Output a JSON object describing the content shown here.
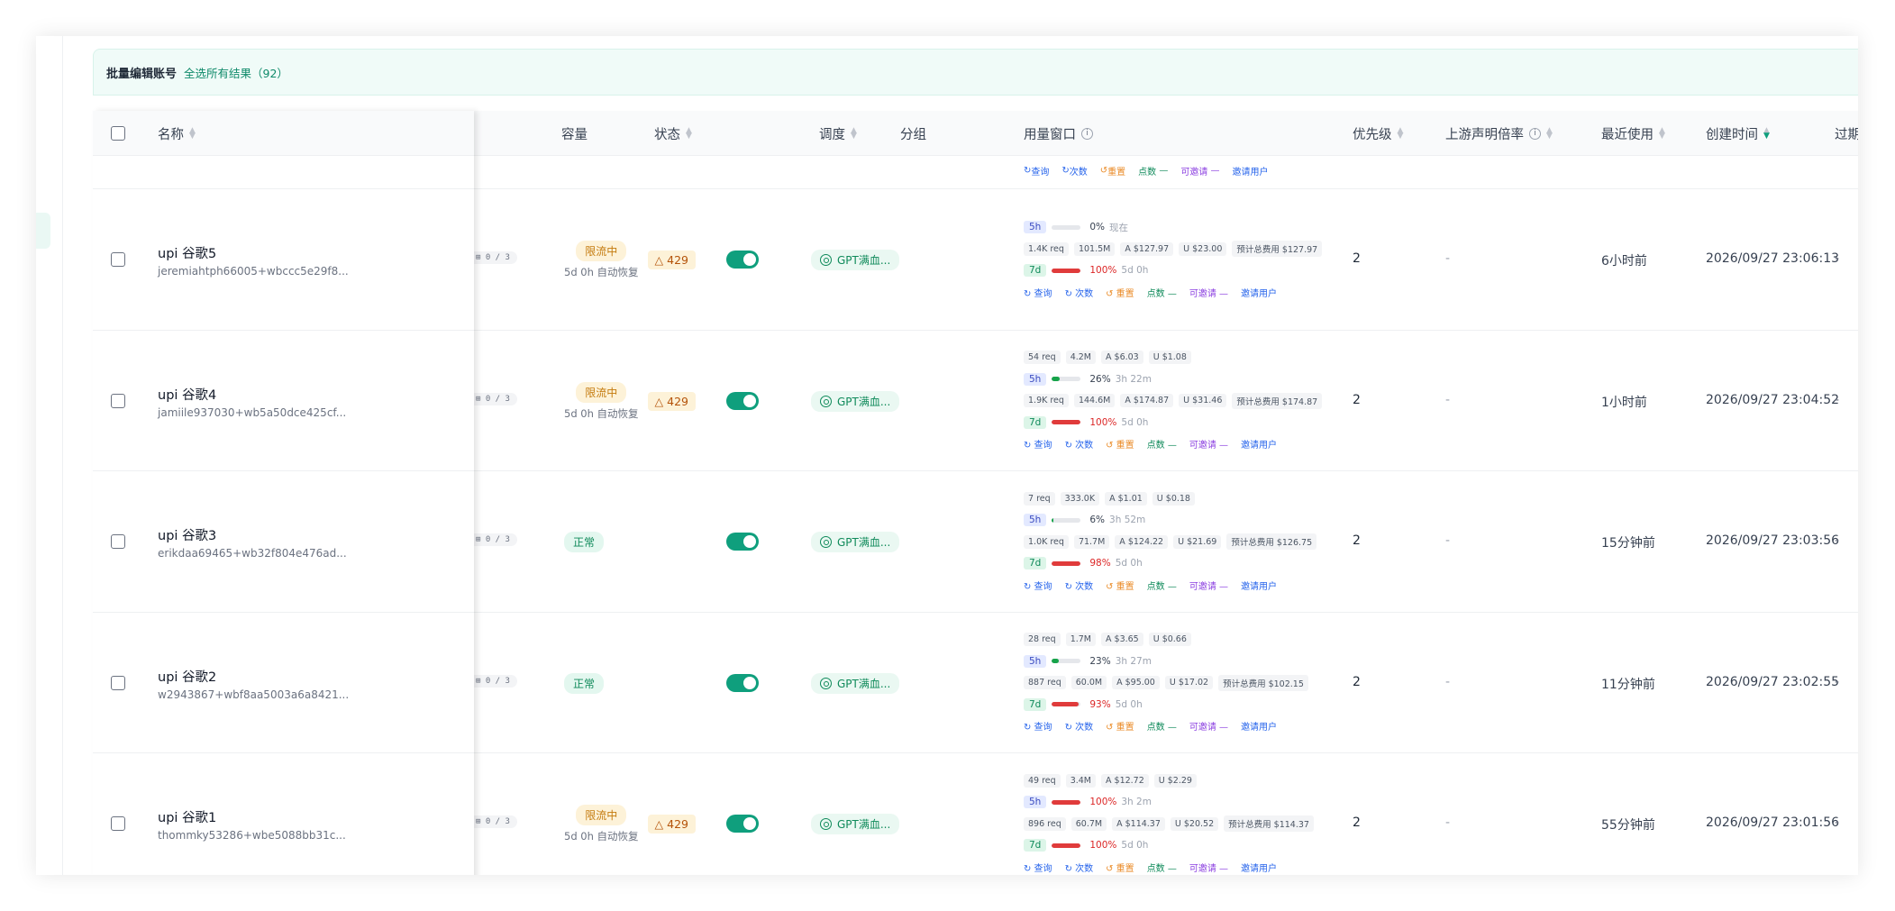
{
  "bulkbar": {
    "title": "批量编辑账号",
    "select_all": "全选所有结果（92）"
  },
  "columns": {
    "name": "名称",
    "capacity": "容量",
    "status": "状态",
    "schedule": "调度",
    "group": "分组",
    "usage_window": "用量窗口",
    "priority": "优先级",
    "upstream_rate": "上游声明倍率",
    "last_used": "最近使用",
    "created_at": "创建时间",
    "expire": "过期"
  },
  "usage_actions": {
    "query": "查询",
    "count": "次数",
    "reset": "重置",
    "points": "点数",
    "points_val": "—",
    "can_invite": "可邀请",
    "can_invite_val": "—",
    "invite_user": "邀请用户"
  },
  "rows": [
    {
      "name": "upi 谷歌5",
      "email": "jeremiahtph66005+wbccc5e29f8...",
      "capacity": "⊞ 0 / 3",
      "status": "限流中",
      "status_type": "limit",
      "status_sub": "5d 0h 自动恢复",
      "code": "△ 429",
      "group": "GPT满血...",
      "usage_5h": {
        "label": "5h",
        "pct": "0%",
        "fill": 0,
        "reset": "现在",
        "color": "gray"
      },
      "chips_7d": [
        "1.4K req",
        "101.5M",
        "A $127.97",
        "U $23.00",
        "预计总费用 $127.97"
      ],
      "usage_7d": {
        "label": "7d",
        "pct": "100%",
        "fill": 100,
        "reset": "5d 0h"
      },
      "priority": "2",
      "upstream": "-",
      "last_used": "6小时前",
      "created": "2026/09/27 23:06:13",
      "expire": "-"
    },
    {
      "name": "upi 谷歌4",
      "email": "jamiile937030+wb5a50dce425cf...",
      "capacity": "⊞ 0 / 3",
      "status": "限流中",
      "status_type": "limit",
      "status_sub": "5d 0h 自动恢复",
      "code": "△ 429",
      "group": "GPT满血...",
      "chips_5h": [
        "54 req",
        "4.2M",
        "A $6.03",
        "U $1.08"
      ],
      "usage_5h": {
        "label": "5h",
        "pct": "26%",
        "fill": 26,
        "reset": "3h 22m",
        "color": "green"
      },
      "chips_7d": [
        "1.9K req",
        "144.6M",
        "A $174.87",
        "U $31.46",
        "预计总费用 $174.87"
      ],
      "usage_7d": {
        "label": "7d",
        "pct": "100%",
        "fill": 100,
        "reset": "5d 0h"
      },
      "priority": "2",
      "upstream": "-",
      "last_used": "1小时前",
      "created": "2026/09/27 23:04:52",
      "expire": "-"
    },
    {
      "name": "upi 谷歌3",
      "email": "erikdaa69465+wb32f804e476ad...",
      "capacity": "⊞ 0 / 3",
      "status": "正常",
      "status_type": "ok",
      "status_sub": "",
      "code": "",
      "group": "GPT满血...",
      "chips_5h": [
        "7 req",
        "333.0K",
        "A $1.01",
        "U $0.18"
      ],
      "usage_5h": {
        "label": "5h",
        "pct": "6%",
        "fill": 6,
        "reset": "3h 52m",
        "color": "green"
      },
      "chips_7d": [
        "1.0K req",
        "71.7M",
        "A $124.22",
        "U $21.69",
        "预计总费用 $126.75"
      ],
      "usage_7d": {
        "label": "7d",
        "pct": "98%",
        "fill": 98,
        "reset": "5d 0h"
      },
      "priority": "2",
      "upstream": "-",
      "last_used": "15分钟前",
      "created": "2026/09/27 23:03:56",
      "expire": "-"
    },
    {
      "name": "upi 谷歌2",
      "email": "w2943867+wbf8aa5003a6a8421...",
      "capacity": "⊞ 0 / 3",
      "status": "正常",
      "status_type": "ok",
      "status_sub": "",
      "code": "",
      "group": "GPT满血...",
      "chips_5h": [
        "28 req",
        "1.7M",
        "A $3.65",
        "U $0.66"
      ],
      "usage_5h": {
        "label": "5h",
        "pct": "23%",
        "fill": 23,
        "reset": "3h 27m",
        "color": "green"
      },
      "chips_7d": [
        "887 req",
        "60.0M",
        "A $95.00",
        "U $17.02",
        "预计总费用 $102.15"
      ],
      "usage_7d": {
        "label": "7d",
        "pct": "93%",
        "fill": 93,
        "reset": "5d 0h"
      },
      "priority": "2",
      "upstream": "-",
      "last_used": "11分钟前",
      "created": "2026/09/27 23:02:55",
      "expire": "-"
    },
    {
      "name": "upi 谷歌1",
      "email": "thommky53286+wbe5088bb31c...",
      "capacity": "⊞ 0 / 3",
      "status": "限流中",
      "status_type": "limit",
      "status_sub": "5d 0h 自动恢复",
      "code": "△ 429",
      "group": "GPT满血...",
      "chips_5h": [
        "49 req",
        "3.4M",
        "A $12.72",
        "U $2.29"
      ],
      "usage_5h": {
        "label": "5h",
        "pct": "100%",
        "fill": 100,
        "reset": "3h 2m",
        "color": "red"
      },
      "chips_7d": [
        "896 req",
        "60.7M",
        "A $114.37",
        "U $20.52",
        "预计总费用 $114.37"
      ],
      "usage_7d": {
        "label": "7d",
        "pct": "100%",
        "fill": 100,
        "reset": "5d 0h"
      },
      "priority": "2",
      "upstream": "-",
      "last_used": "55分钟前",
      "created": "2026/09/27 23:01:56",
      "expire": "-"
    }
  ],
  "colors": {
    "accent": "#0f9f7d",
    "red": "#e03b3b",
    "green": "#16a34a"
  }
}
